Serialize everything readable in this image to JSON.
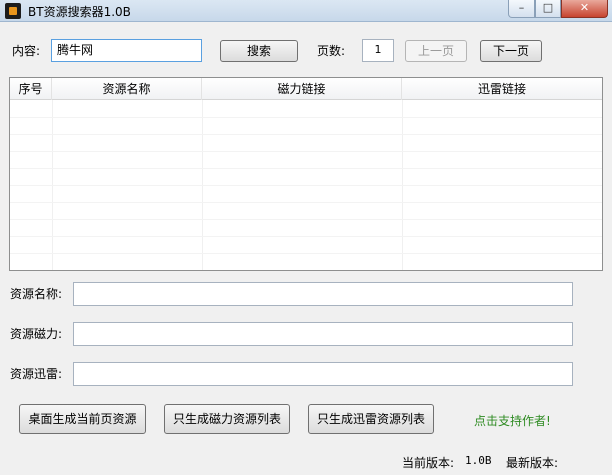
{
  "window": {
    "title": "BT资源搜索器1.0B",
    "minimize_glyph": "–",
    "maximize_glyph": "□",
    "close_glyph": "✕"
  },
  "search": {
    "content_label": "内容:",
    "content_value": "腾牛网",
    "search_button": "搜索",
    "page_label": "页数:",
    "page_value": "1",
    "prev_button": "上一页",
    "next_button": "下一页"
  },
  "table": {
    "columns": [
      "序号",
      "资源名称",
      "磁力链接",
      "迅雷链接"
    ],
    "rows": []
  },
  "details": {
    "name_label": "资源名称:",
    "name_value": "",
    "magnet_label": "资源磁力:",
    "magnet_value": "",
    "thunder_label": "资源迅雷:",
    "thunder_value": ""
  },
  "actions": {
    "generate_page_button": "桌面生成当前页资源",
    "magnet_list_button": "只生成磁力资源列表",
    "thunder_list_button": "只生成迅雷资源列表",
    "support_link": "点击支持作者!"
  },
  "status": {
    "current_version_label": "当前版本:",
    "current_version": "1.0B",
    "latest_version_label": "最新版本:",
    "latest_version": ""
  },
  "colors": {
    "support_link": "#2e8b22",
    "close_button": "#c7442f"
  }
}
